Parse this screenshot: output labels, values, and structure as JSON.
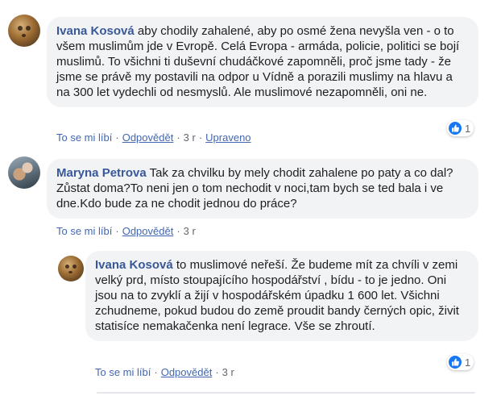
{
  "comments": [
    {
      "author": "Ivana Kosová",
      "text": "aby chodily zahalené, aby po osmé žena nevyšla ven - o to všem muslimům jde v Evropě. Celá Evropa - armáda, policie, politici se bojí muslimů. To všichni ti duševní chudáčkové zapomněli, proč jsme tady - že jsme se právě my postavili na odpor u Vídně a porazili muslimy na hlavu a na 300 let vydechli od nesmyslů. Ale muslimové nezapomněli, oni ne.",
      "reaction_count": "1",
      "like": "To se mi líbí",
      "reply": "Odpovědět",
      "time": "3 r",
      "edited": "Upraveno"
    },
    {
      "author": "Maryna Petrova",
      "text": "Tak za chvilku by mely chodit zahalene po paty a co dal?Zůstat doma?To neni jen o tom nechodit v noci,tam bych se ted bala i ve dne.Kdo bude za ne chodit jednou do práce?",
      "like": "To se mi líbí",
      "reply": "Odpovědět",
      "time": "3 r"
    },
    {
      "author": "Ivana Kosová",
      "text": "to muslimové neřeší. Že budeme mít za chvíli v zemi velký prd, místo stoupajícího hospodářství , bídu - to je jedno. Oni jsou na to zvyklí a žijí v hospodářském úpadku 1 600 let. Všichni zchudneme, pokud budou do země proudit bandy černých opic, živit statisíce nemakačenka není legrace. Vše se zhroutí.",
      "reaction_count": "1",
      "like": "To se mi líbí",
      "reply": "Odpovědět",
      "time": "3 r"
    }
  ],
  "separator": "·",
  "icons": {
    "avatar_1": "cheetah-avatar",
    "avatar_2": "person-avatar",
    "avatar_3": "cheetah-avatar",
    "reaction": "like-thumb-icon"
  },
  "colors": {
    "author": "#385898",
    "link": "#4267b2",
    "like_blue": "#1877f2",
    "bubble": "#f2f3f5"
  }
}
